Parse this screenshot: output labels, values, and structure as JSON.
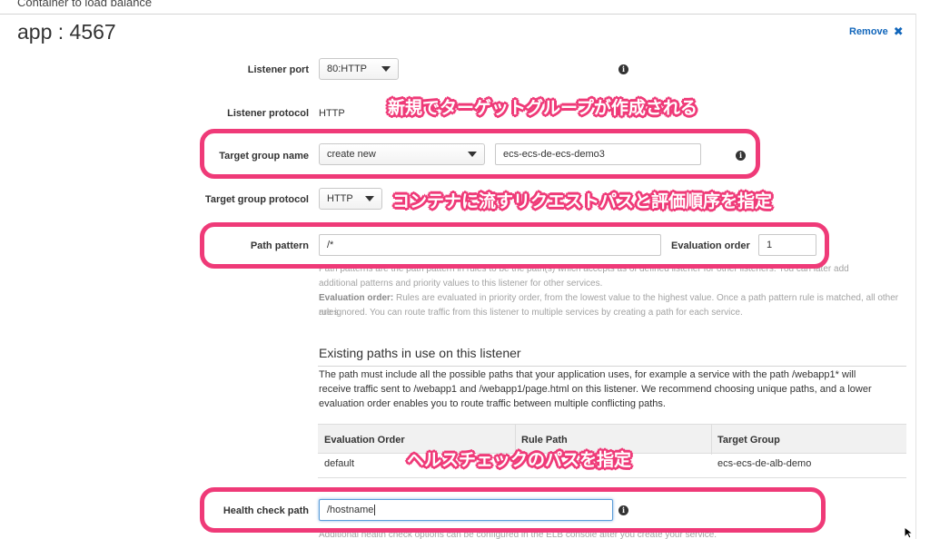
{
  "section": {
    "caption": "Container to load balance",
    "title": "app : 4567",
    "remove_label": "Remove"
  },
  "form": {
    "listener_port": {
      "label": "Listener port",
      "value": "80:HTTP"
    },
    "listener_protocol": {
      "label": "Listener protocol",
      "value": "HTTP"
    },
    "target_group_name": {
      "label": "Target group name",
      "select_value": "create new",
      "input_value": "ecs-ecs-de-ecs-demo3"
    },
    "target_group_protocol": {
      "label": "Target group protocol",
      "value": "HTTP"
    },
    "path_pattern": {
      "label": "Path pattern",
      "value": "/*"
    },
    "evaluation_order": {
      "label": "Evaluation order",
      "value": "1"
    },
    "health_check_path": {
      "label": "Health check path",
      "value": "/hostname"
    }
  },
  "help": {
    "path_line1": "Path patterns are the path pattern in rules to be the path(s) which accepts as of defined listener for other listeners. You can later add",
    "path_line2": "additional patterns and priority values to this listener for other services.",
    "eval_bold": "Evaluation order:",
    "eval_line1": " Rules are evaluated in priority order, from the lowest value to the highest value. Once a path pattern rule is matched, all other rules",
    "eval_line2": "are ignored. You can route traffic from this listener to multiple services by creating a path for each service.",
    "health": "Additional health check options can be configured in the ELB console after you create your service."
  },
  "existing_paths": {
    "heading": "Existing paths in use on this listener",
    "desc_line1": "The path must include all the possible paths that your application uses, for example a service with the path /webapp1* will",
    "desc_line2": "receive traffic sent to /webapp1 and /webapp1/page.html on this listener. We recommend choosing unique paths, and a lower",
    "desc_line3": "evaluation order enables you to route traffic between multiple conflicting paths.",
    "columns": [
      "Evaluation Order",
      "Rule Path",
      "Target Group"
    ],
    "rows": [
      {
        "order": "default",
        "path": "",
        "group": "ecs-ecs-de-alb-demo"
      }
    ]
  },
  "annotations": {
    "target_group": "新規でターゲットグループが作成される",
    "path": "コンテナに流すリクエストパスと評価順序を指定",
    "health": "ヘルスチェックのパスを指定"
  },
  "colors": {
    "highlight": "#ef3a78",
    "link": "#1166bb"
  }
}
